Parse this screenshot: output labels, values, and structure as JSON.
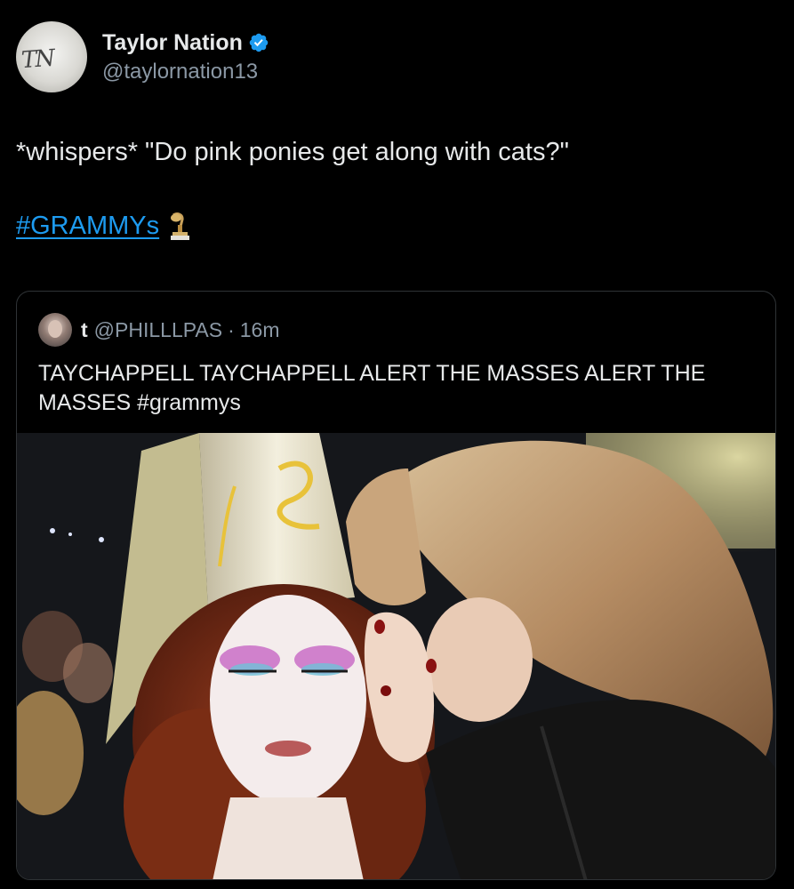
{
  "tweet": {
    "author": {
      "display_name": "Taylor Nation",
      "handle": "@taylornation13",
      "verified": true,
      "avatar_monogram": "TN"
    },
    "text": "*whispers* \"Do pink ponies get along with cats?\"",
    "hashtag": "#GRAMMYs",
    "hashtag_icon": "gramophone-icon",
    "link_color": "#1d9bf0"
  },
  "quoted_tweet": {
    "author": {
      "display_name": "t",
      "handle": "@PHILLLPAS"
    },
    "separator": "·",
    "timestamp": "16m",
    "text": "TAYCHAPPELL TAYCHAPPELL ALERT THE MASSES ALERT THE MASSES #grammys",
    "photo": "two-women-whispering-photo"
  }
}
